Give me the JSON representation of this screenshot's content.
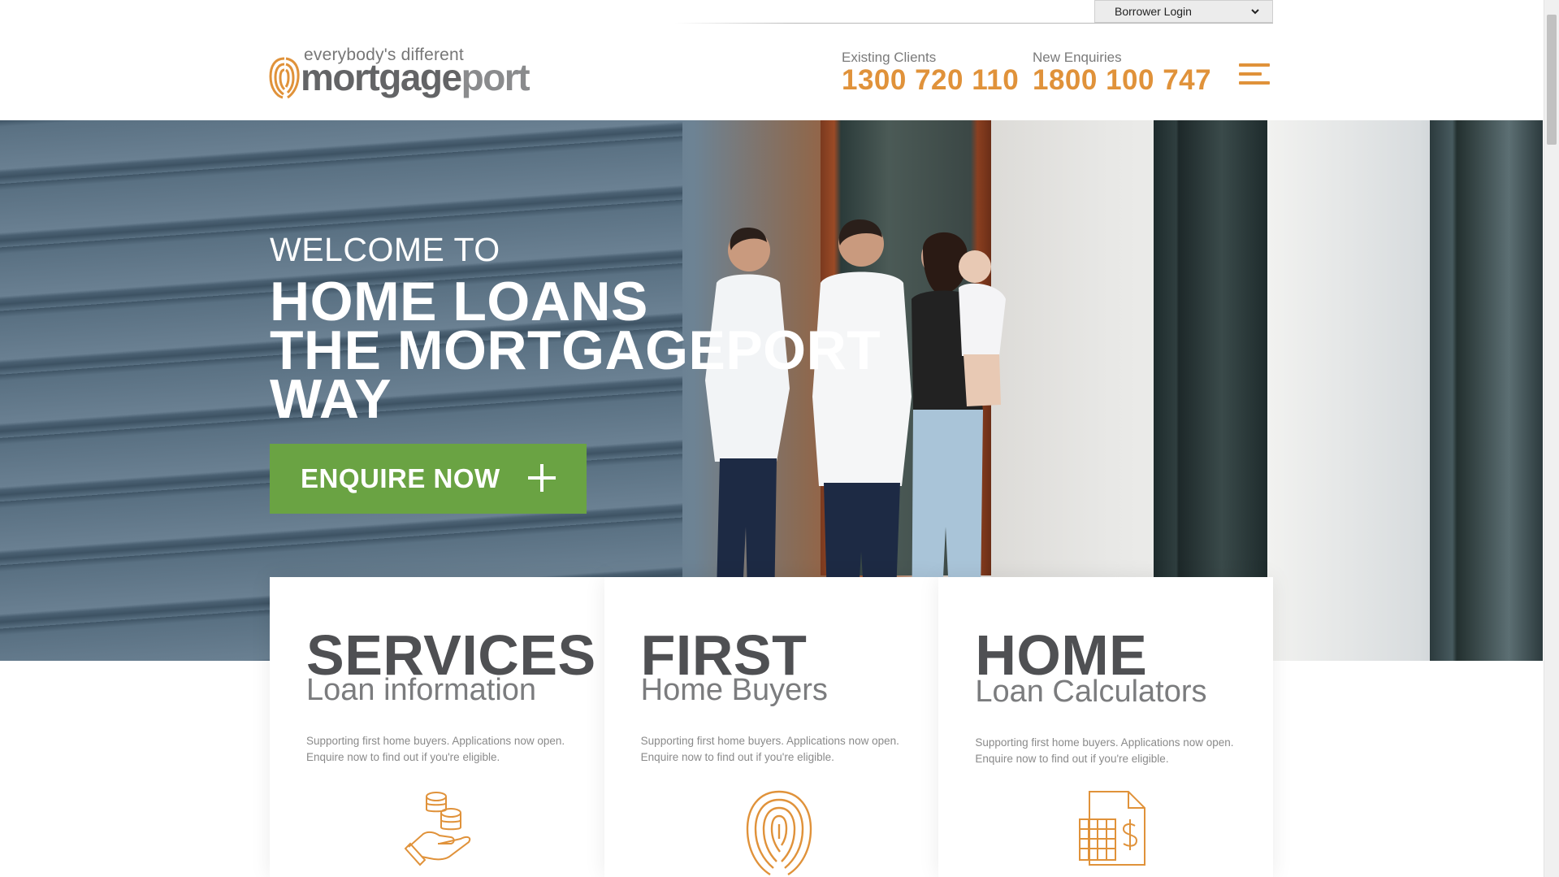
{
  "borrower_login": {
    "label": "Borrower Login",
    "icon": "chevron-down-icon"
  },
  "logo": {
    "tagline": "everybody's different",
    "word_part1": "mortgage",
    "word_part2": "port",
    "icon": "fingerprint-icon"
  },
  "contacts": {
    "existing": {
      "label": "Existing Clients",
      "number": "1300 720 110"
    },
    "new": {
      "label": "New Enquiries",
      "number": "1800 100 747"
    }
  },
  "menu": {
    "icon": "hamburger-menu-icon"
  },
  "hero": {
    "welcome": "WELCOME TO",
    "line1": "HOME LOANS",
    "line2": "THE MORTGAGEPORT",
    "line3": "WAY",
    "cta": "ENQUIRE NOW",
    "cta_icon": "plus-icon"
  },
  "cards": [
    {
      "title": "SERVICES",
      "subtitle": "Loan information",
      "desc": "Supporting first home buyers. Applications now open. Enquire now to find out if you're eligible.",
      "icon": "coins-hand-icon"
    },
    {
      "title": "FIRST",
      "subtitle": "Home Buyers",
      "desc": "Supporting first home buyers. Applications now open. Enquire now to find out if you're eligible.",
      "icon": "fingerprint-icon"
    },
    {
      "title": "HOME",
      "subtitle": "Loan Calculators",
      "desc": "Supporting first home buyers. Applications now open. Enquire now to find out if you're eligible.",
      "icon": "calculator-document-icon"
    }
  ],
  "colors": {
    "accent_orange": "#e0923a",
    "cta_green": "#6aa343",
    "heading_grey": "#4f5053"
  }
}
